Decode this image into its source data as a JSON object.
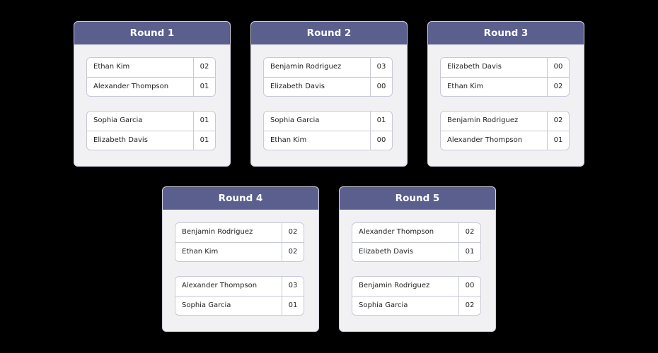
{
  "rounds": [
    {
      "title": "Round 1",
      "matches": [
        {
          "players": [
            {
              "name": "Ethan Kim",
              "score": "02"
            },
            {
              "name": "Alexander Thompson",
              "score": "01"
            }
          ]
        },
        {
          "players": [
            {
              "name": "Sophia Garcia",
              "score": "01"
            },
            {
              "name": "Elizabeth Davis",
              "score": "01"
            }
          ]
        }
      ]
    },
    {
      "title": "Round 2",
      "matches": [
        {
          "players": [
            {
              "name": "Benjamin Rodriguez",
              "score": "03"
            },
            {
              "name": "Elizabeth Davis",
              "score": "00"
            }
          ]
        },
        {
          "players": [
            {
              "name": "Sophia Garcia",
              "score": "01"
            },
            {
              "name": "Ethan Kim",
              "score": "00"
            }
          ]
        }
      ]
    },
    {
      "title": "Round 3",
      "matches": [
        {
          "players": [
            {
              "name": "Elizabeth Davis",
              "score": "00"
            },
            {
              "name": "Ethan Kim",
              "score": "02"
            }
          ]
        },
        {
          "players": [
            {
              "name": "Benjamin Rodriguez",
              "score": "02"
            },
            {
              "name": "Alexander Thompson",
              "score": "01"
            }
          ]
        }
      ]
    },
    {
      "title": "Round 4",
      "matches": [
        {
          "players": [
            {
              "name": "Benjamin Rodriguez",
              "score": "02"
            },
            {
              "name": "Ethan Kim",
              "score": "02"
            }
          ]
        },
        {
          "players": [
            {
              "name": "Alexander Thompson",
              "score": "03"
            },
            {
              "name": "Sophia Garcia",
              "score": "01"
            }
          ]
        }
      ]
    },
    {
      "title": "Round 5",
      "matches": [
        {
          "players": [
            {
              "name": "Alexander Thompson",
              "score": "02"
            },
            {
              "name": "Elizabeth Davis",
              "score": "01"
            }
          ]
        },
        {
          "players": [
            {
              "name": "Benjamin Rodriguez",
              "score": "00"
            },
            {
              "name": "Sophia Garcia",
              "score": "02"
            }
          ]
        }
      ]
    }
  ],
  "colors": {
    "header": "#5b5f8e",
    "card": "#f1f1f3",
    "border": "#c8c9d8",
    "background": "#000000"
  }
}
